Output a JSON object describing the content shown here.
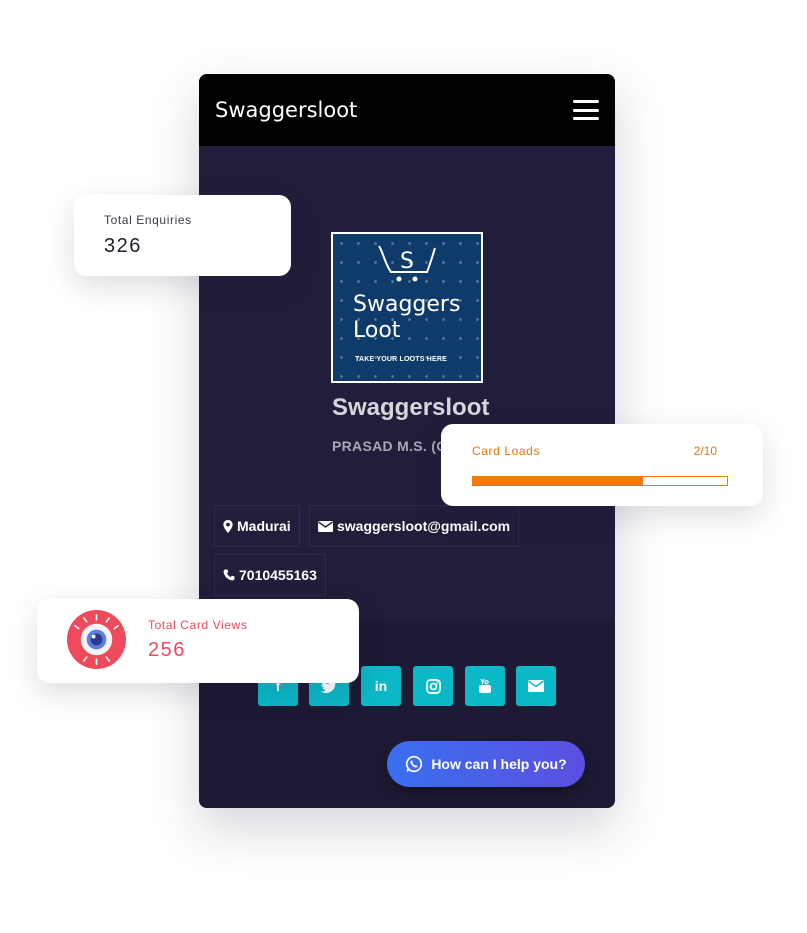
{
  "navbar": {
    "brand": "Swaggersloot"
  },
  "profile": {
    "logo_line1": "Swaggers",
    "logo_line2": "Loot",
    "logo_tagline": "TAKE YOUR LOOTS HERE",
    "name": "Swaggersloot",
    "subtitle": "PRASAD M.S. (OWNER)"
  },
  "contacts": {
    "location": "Madurai",
    "email": "swaggersloot@gmail.com",
    "phone": "7010455163"
  },
  "social": [
    "facebook-icon",
    "twitter-icon",
    "linkedin-icon",
    "instagram-icon",
    "youtube-icon",
    "mail-icon"
  ],
  "chat": {
    "label": "How can I help you?"
  },
  "stats": {
    "enquiries": {
      "label": "Total Enquiries",
      "value": "326"
    },
    "card_loads": {
      "label": "Card Loads",
      "count": "2/10",
      "progress": 0.67
    },
    "card_views": {
      "label": "Total Card Views",
      "value": "256"
    }
  },
  "colors": {
    "accent_teal": "#0bb8c8",
    "orange": "#f07a10",
    "pink": "#ee4a5f",
    "phone_bg": "#221d3b"
  }
}
